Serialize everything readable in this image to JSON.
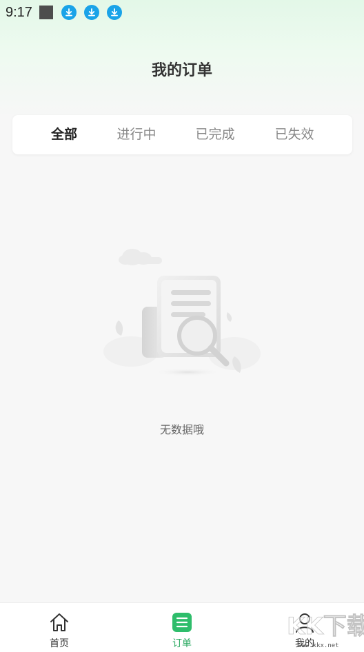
{
  "status_bar": {
    "time": "9:17",
    "icons": [
      "notification-square-icon",
      "download-icon",
      "download-icon",
      "download-icon"
    ],
    "download_color": "#1aa3e8"
  },
  "header": {
    "title": "我的订单"
  },
  "tabs": [
    {
      "label": "全部",
      "active": true
    },
    {
      "label": "进行中",
      "active": false
    },
    {
      "label": "已完成",
      "active": false
    },
    {
      "label": "已失效",
      "active": false
    }
  ],
  "empty_state": {
    "icon": "document-search-illustration",
    "message": "无数据哦"
  },
  "bottom_nav": {
    "items": [
      {
        "label": "首页",
        "icon": "home-icon",
        "active": false
      },
      {
        "label": "订单",
        "icon": "order-list-icon",
        "active": true
      },
      {
        "label": "我的",
        "icon": "person-icon",
        "active": false
      }
    ],
    "active_color": "#2aa860"
  },
  "watermark": {
    "brand": "KK下载",
    "url": "www.kkx.net"
  }
}
